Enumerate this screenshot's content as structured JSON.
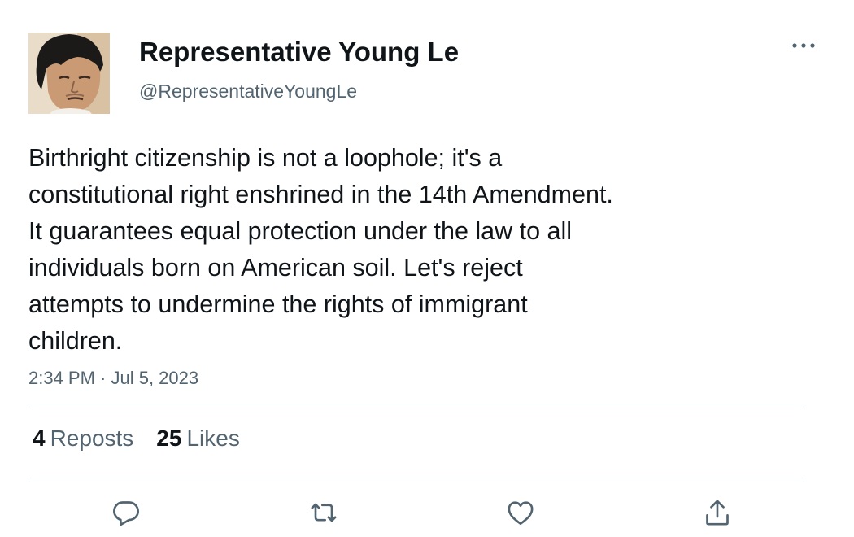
{
  "author": {
    "display_name": "Representative Young Le",
    "handle": "@RepresentativeYoungLe",
    "avatar_icon": "profile-photo"
  },
  "tweet": {
    "text": "Birthright citizenship is not a loophole; it's a\nconstitutional right enshrined in the 14th Amendment.\nIt guarantees equal protection under the law to all\nindividuals born on American soil. Let's reject\nattempts to undermine the rights of immigrant\nchildren.",
    "timestamp": "2:34 PM · Jul 5, 2023"
  },
  "stats": {
    "reposts_count": "4",
    "reposts_label": "Reposts",
    "likes_count": "25",
    "likes_label": "Likes"
  },
  "actions": {
    "reply_icon": "comment-icon",
    "repost_icon": "repost-icon",
    "like_icon": "heart-icon",
    "share_icon": "share-icon"
  },
  "colors": {
    "text_primary": "#0f1419",
    "text_secondary": "#536471",
    "divider": "#cfd9de"
  }
}
